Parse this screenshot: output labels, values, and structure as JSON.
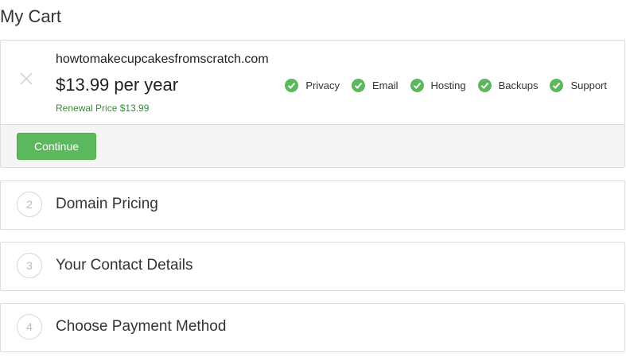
{
  "page": {
    "title": "My Cart"
  },
  "cart_item": {
    "domain": "howtomakecupcakesfromscratch.com",
    "price": "$13.99 per year",
    "renewal": "Renewal Price $13.99",
    "features": [
      {
        "label": "Privacy",
        "icon": "check-circle-icon"
      },
      {
        "label": "Email",
        "icon": "check-circle-icon"
      },
      {
        "label": "Hosting",
        "icon": "check-circle-icon"
      },
      {
        "label": "Backups",
        "icon": "check-circle-icon"
      },
      {
        "label": "Support",
        "icon": "check-circle-icon"
      }
    ],
    "continue_label": "Continue"
  },
  "steps": [
    {
      "number": "2",
      "label": "Domain Pricing"
    },
    {
      "number": "3",
      "label": "Your Contact Details"
    },
    {
      "number": "4",
      "label": "Choose Payment Method"
    }
  ],
  "colors": {
    "accent_green": "#5cb85c",
    "renewal_green": "#3a8a3a",
    "border": "#dddddd"
  }
}
